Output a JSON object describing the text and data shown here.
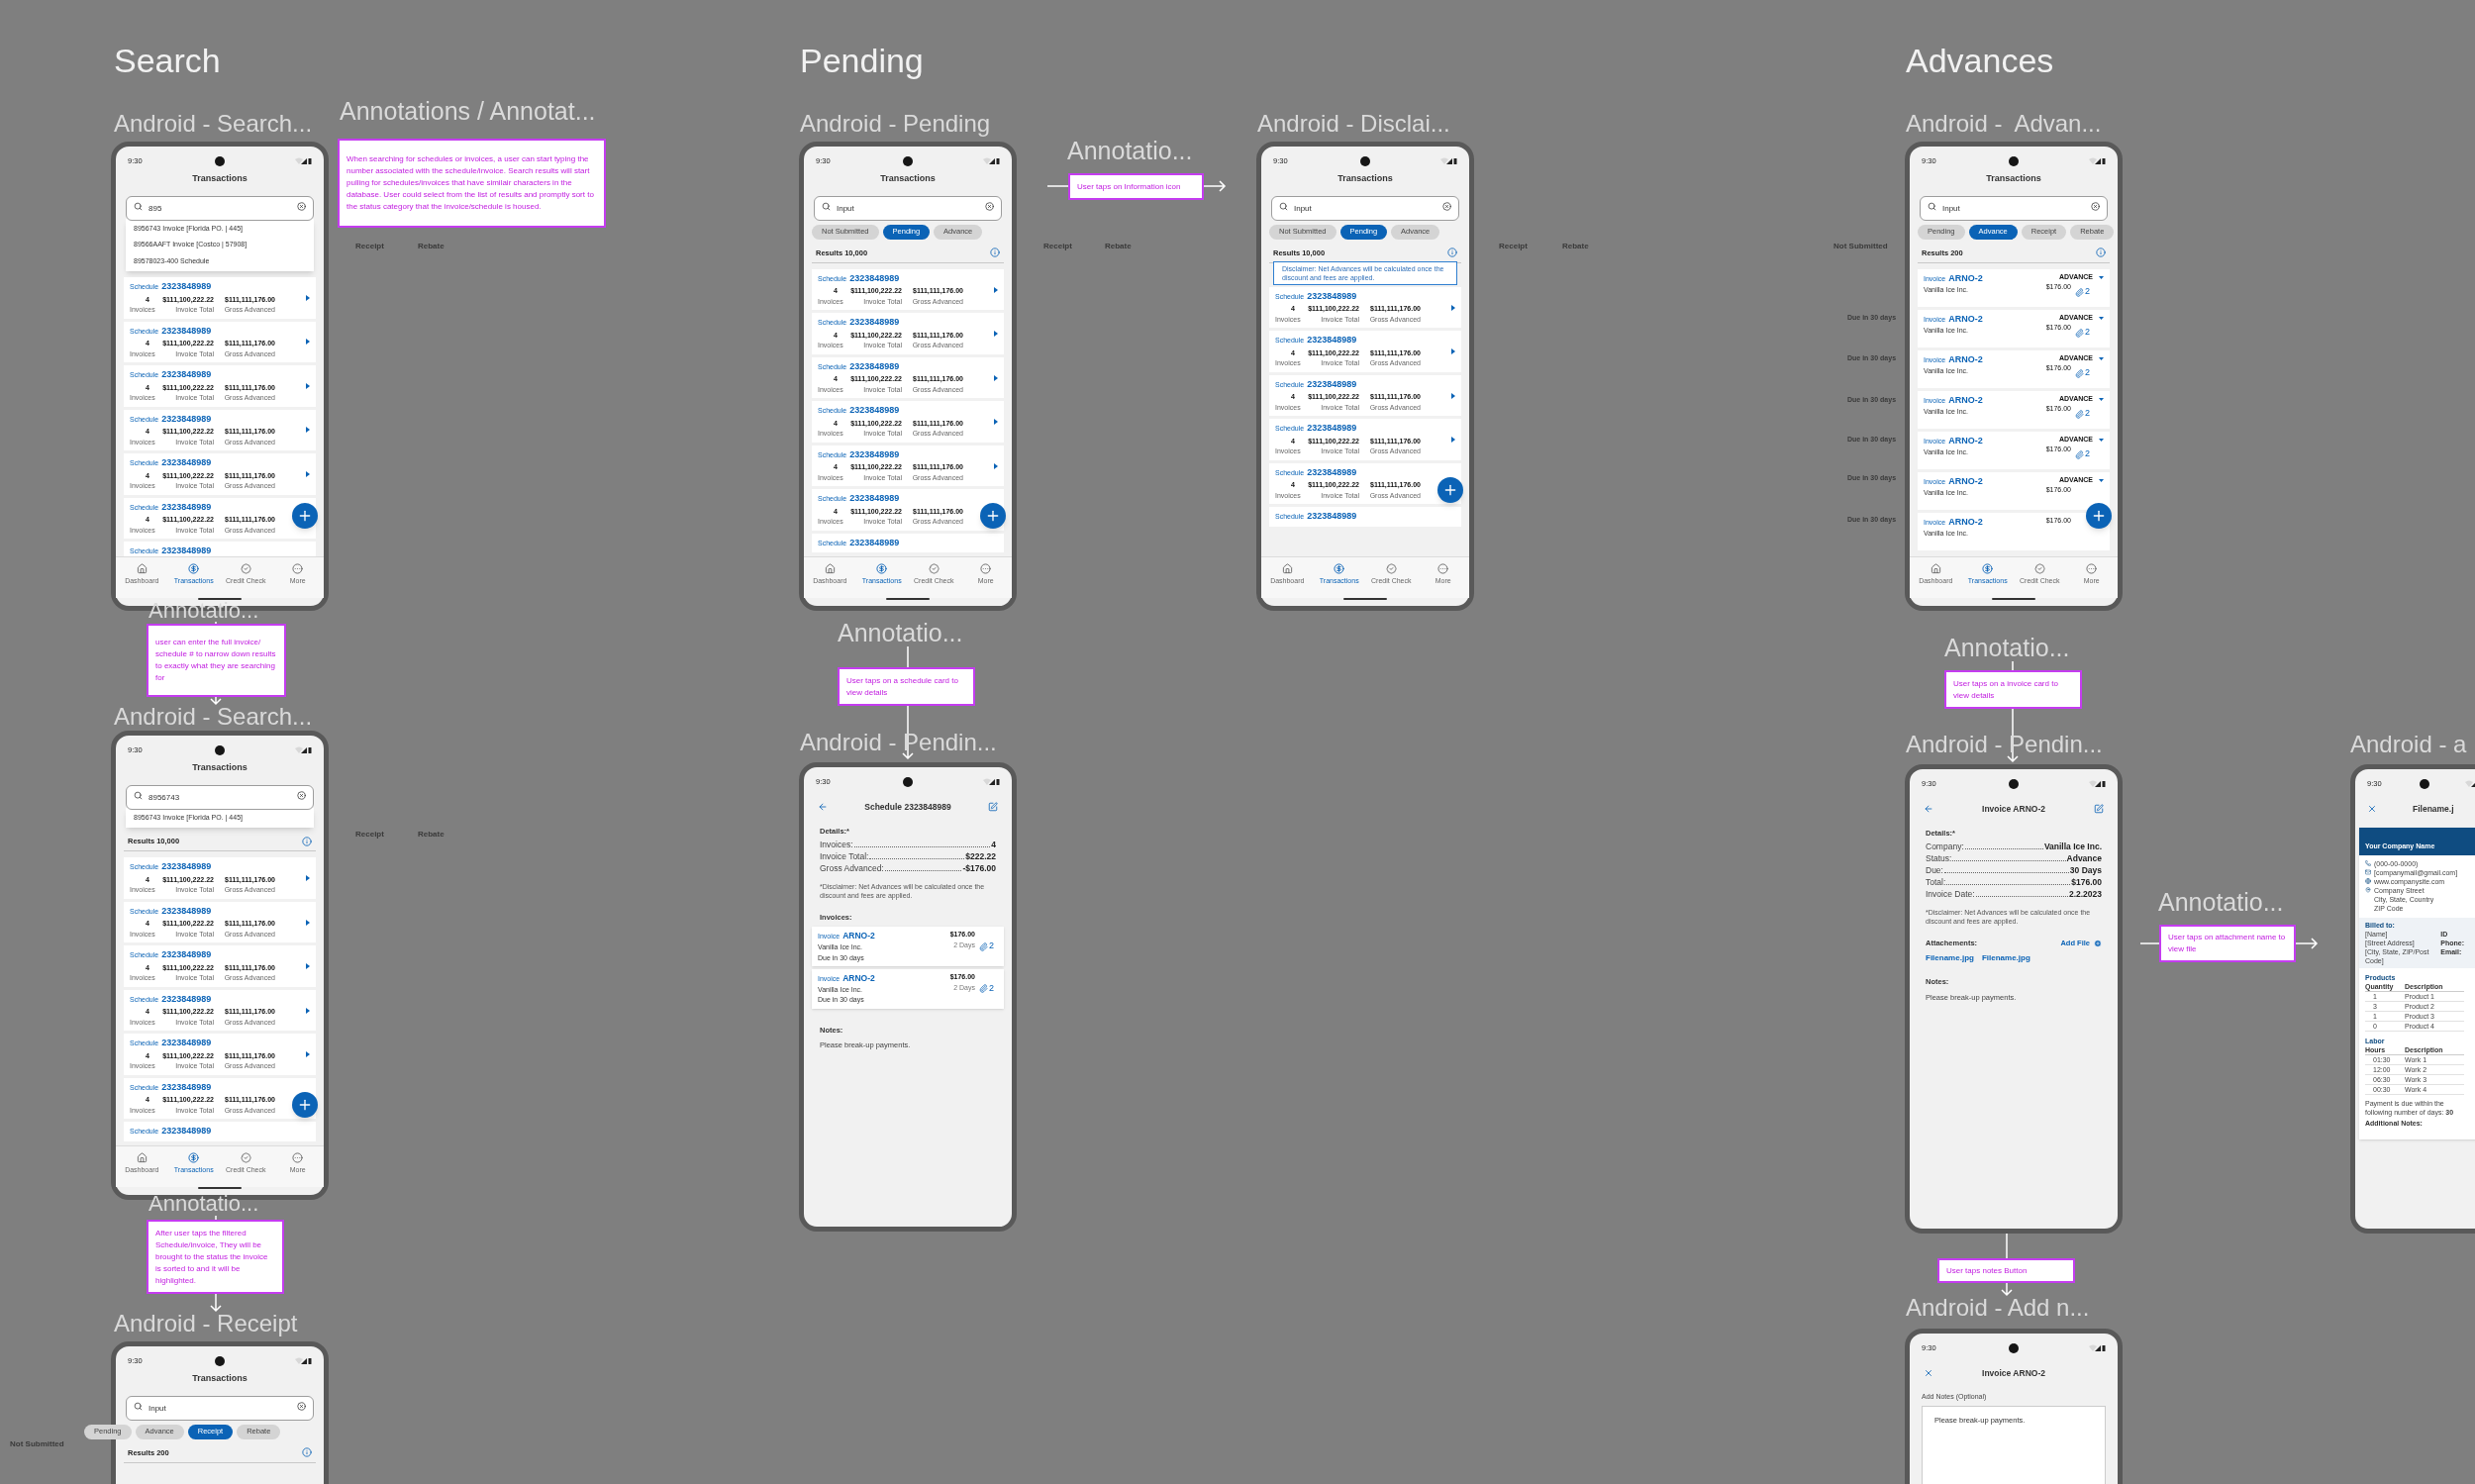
{
  "sections": [
    {
      "title": "Search"
    },
    {
      "title": "Pending"
    },
    {
      "title": "Advances"
    }
  ],
  "frames": [
    {
      "kind": "list",
      "label": "Android - Search...",
      "time": "9:30",
      "title": "Transactions",
      "search": {
        "value": "895"
      },
      "suggestions": [
        "8956743 Invoice [Florida PO. | 445]",
        "89566AAFT Invoice [Costco | 57908]",
        "89578023-400 Schedule"
      ],
      "cards": [
        {
          "label": "Schedule",
          "number": "2323848989",
          "invoices": "4",
          "invoices_label": "Invoices",
          "total": "$111,100,222.22",
          "total_label": "Invoice Total",
          "advanced": "$111,111,176.00",
          "advanced_label": "Gross Advanced"
        },
        {
          "label": "Schedule",
          "number": "2323848989",
          "invoices": "4",
          "invoices_label": "Invoices",
          "total": "$111,100,222.22",
          "total_label": "Invoice Total",
          "advanced": "$111,111,176.00",
          "advanced_label": "Gross Advanced"
        },
        {
          "label": "Schedule",
          "number": "2323848989",
          "invoices": "4",
          "invoices_label": "Invoices",
          "total": "$111,100,222.22",
          "total_label": "Invoice Total",
          "advanced": "$111,111,176.00",
          "advanced_label": "Gross Advanced"
        },
        {
          "label": "Schedule",
          "number": "2323848989",
          "invoices": "4",
          "invoices_label": "Invoices",
          "total": "$111,100,222.22",
          "total_label": "Invoice Total",
          "advanced": "$111,111,176.00",
          "advanced_label": "Gross Advanced"
        },
        {
          "label": "Schedule",
          "number": "2323848989",
          "invoices": "4",
          "invoices_label": "Invoices",
          "total": "$111,100,222.22",
          "total_label": "Invoice Total",
          "advanced": "$111,111,176.00",
          "advanced_label": "Gross Advanced"
        },
        {
          "label": "Schedule",
          "number": "2323848989",
          "invoices": "4",
          "invoices_label": "Invoices",
          "total": "$111,100,222.22",
          "total_label": "Invoice Total",
          "advanced": "$111,111,176.00",
          "advanced_label": "Gross Advanced"
        },
        {
          "label": "Schedule",
          "number": "2323848989"
        }
      ],
      "nav": [
        {
          "label": "Dashboard",
          "selected": false
        },
        {
          "label": "Transactions",
          "selected": true
        },
        {
          "label": "Credit Check",
          "selected": false
        },
        {
          "label": "More",
          "selected": false
        }
      ]
    },
    {
      "kind": "list",
      "label": "Android - Search...",
      "time": "9:30",
      "title": "Transactions",
      "search": {
        "value": "8956743"
      },
      "suggestions": [
        "8956743 Invoice [Florida PO. | 445]"
      ],
      "results": "Results 10,000",
      "cards": [
        {
          "label": "Schedule",
          "number": "2323848989",
          "invoices": "4",
          "invoices_label": "Invoices",
          "total": "$111,100,222.22",
          "total_label": "Invoice Total",
          "advanced": "$111,111,176.00",
          "advanced_label": "Gross Advanced"
        },
        {
          "label": "Schedule",
          "number": "2323848989",
          "invoices": "4",
          "invoices_label": "Invoices",
          "total": "$111,100,222.22",
          "total_label": "Invoice Total",
          "advanced": "$111,111,176.00",
          "advanced_label": "Gross Advanced"
        },
        {
          "label": "Schedule",
          "number": "2323848989",
          "invoices": "4",
          "invoices_label": "Invoices",
          "total": "$111,100,222.22",
          "total_label": "Invoice Total",
          "advanced": "$111,111,176.00",
          "advanced_label": "Gross Advanced"
        },
        {
          "label": "Schedule",
          "number": "2323848989",
          "invoices": "4",
          "invoices_label": "Invoices",
          "total": "$111,100,222.22",
          "total_label": "Invoice Total",
          "advanced": "$111,111,176.00",
          "advanced_label": "Gross Advanced"
        },
        {
          "label": "Schedule",
          "number": "2323848989",
          "invoices": "4",
          "invoices_label": "Invoices",
          "total": "$111,100,222.22",
          "total_label": "Invoice Total",
          "advanced": "$111,111,176.00",
          "advanced_label": "Gross Advanced"
        },
        {
          "label": "Schedule",
          "number": "2323848989",
          "invoices": "4",
          "invoices_label": "Invoices",
          "total": "$111,100,222.22",
          "total_label": "Invoice Total",
          "advanced": "$111,111,176.00",
          "advanced_label": "Gross Advanced"
        },
        {
          "label": "Schedule",
          "number": "2323848989"
        }
      ],
      "nav": [
        {
          "label": "Dashboard",
          "selected": false
        },
        {
          "label": "Transactions",
          "selected": true
        },
        {
          "label": "Credit Check",
          "selected": false
        },
        {
          "label": "More",
          "selected": false
        }
      ]
    },
    {
      "kind": "list",
      "label": "Android - Receipt",
      "time": "9:30",
      "title": "Transactions",
      "search": {
        "value": "Input"
      },
      "chips": [
        {
          "label": "Pending",
          "selected": false
        },
        {
          "label": "Advance",
          "selected": false
        },
        {
          "label": "Receipt",
          "selected": true
        },
        {
          "label": "Rebate",
          "selected": false
        }
      ],
      "results": "Results 200"
    },
    {
      "kind": "list",
      "label": "Android - Pending",
      "time": "9:30",
      "title": "Transactions",
      "search": {
        "value": "Input"
      },
      "chips": [
        {
          "label": "Not Submitted",
          "selected": false
        },
        {
          "label": "Pending",
          "selected": true
        },
        {
          "label": "Advance",
          "selected": false
        }
      ],
      "results": "Results 10,000",
      "cards": [
        {
          "label": "Schedule",
          "number": "2323848989",
          "invoices": "4",
          "invoices_label": "Invoices",
          "total": "$111,100,222.22",
          "total_label": "Invoice Total",
          "advanced": "$111,111,176.00",
          "advanced_label": "Gross Advanced"
        },
        {
          "label": "Schedule",
          "number": "2323848989",
          "invoices": "4",
          "invoices_label": "Invoices",
          "total": "$111,100,222.22",
          "total_label": "Invoice Total",
          "advanced": "$111,111,176.00",
          "advanced_label": "Gross Advanced"
        },
        {
          "label": "Schedule",
          "number": "2323848989",
          "invoices": "4",
          "invoices_label": "Invoices",
          "total": "$111,100,222.22",
          "total_label": "Invoice Total",
          "advanced": "$111,111,176.00",
          "advanced_label": "Gross Advanced"
        },
        {
          "label": "Schedule",
          "number": "2323848989",
          "invoices": "4",
          "invoices_label": "Invoices",
          "total": "$111,100,222.22",
          "total_label": "Invoice Total",
          "advanced": "$111,111,176.00",
          "advanced_label": "Gross Advanced"
        },
        {
          "label": "Schedule",
          "number": "2323848989",
          "invoices": "4",
          "invoices_label": "Invoices",
          "total": "$111,100,222.22",
          "total_label": "Invoice Total",
          "advanced": "$111,111,176.00",
          "advanced_label": "Gross Advanced"
        },
        {
          "label": "Schedule",
          "number": "2323848989",
          "invoices": "4",
          "invoices_label": "Invoices",
          "total": "$111,100,222.22",
          "total_label": "Invoice Total",
          "advanced": "$111,111,176.00",
          "advanced_label": "Gross Advanced"
        },
        {
          "label": "Schedule",
          "number": "2323848989"
        }
      ],
      "nav": [
        {
          "label": "Dashboard",
          "selected": false
        },
        {
          "label": "Transactions",
          "selected": true
        },
        {
          "label": "Credit Check",
          "selected": false
        },
        {
          "label": "More",
          "selected": false
        }
      ]
    },
    {
      "kind": "list",
      "label": "Android - Disclai...",
      "time": "9:30",
      "title": "Transactions",
      "search": {
        "value": "Input"
      },
      "chips": [
        {
          "label": "Not Submitted",
          "selected": false
        },
        {
          "label": "Pending",
          "selected": true
        },
        {
          "label": "Advance",
          "selected": false
        }
      ],
      "results": "Results 10,000",
      "tooltip": "Disclaimer: Net Advances will be calculated once the discount and fees are applied.",
      "cards": [
        {
          "label": "Schedule",
          "number": "2323848989",
          "invoices": "4",
          "invoices_label": "Invoices",
          "total": "$111,100,222.22",
          "total_label": "Invoice Total",
          "advanced": "$111,111,176.00",
          "advanced_label": "Gross Advanced"
        },
        {
          "label": "Schedule",
          "number": "2323848989",
          "invoices": "4",
          "invoices_label": "Invoices",
          "total": "$111,100,222.22",
          "total_label": "Invoice Total",
          "advanced": "$111,111,176.00",
          "advanced_label": "Gross Advanced"
        },
        {
          "label": "Schedule",
          "number": "2323848989",
          "invoices": "4",
          "invoices_label": "Invoices",
          "total": "$111,100,222.22",
          "total_label": "Invoice Total",
          "advanced": "$111,111,176.00",
          "advanced_label": "Gross Advanced"
        },
        {
          "label": "Schedule",
          "number": "2323848989",
          "invoices": "4",
          "invoices_label": "Invoices",
          "total": "$111,100,222.22",
          "total_label": "Invoice Total",
          "advanced": "$111,111,176.00",
          "advanced_label": "Gross Advanced"
        },
        {
          "label": "Schedule",
          "number": "2323848989",
          "invoices": "4",
          "invoices_label": "Invoices",
          "total": "$111,100,222.22",
          "total_label": "Invoice Total",
          "advanced": "$111,111,176.00",
          "advanced_label": "Gross Advanced"
        },
        {
          "label": "Schedule",
          "number": "2323848989"
        }
      ],
      "nav": [
        {
          "label": "Dashboard",
          "selected": false
        },
        {
          "label": "Transactions",
          "selected": true
        },
        {
          "label": "Credit Check",
          "selected": false
        },
        {
          "label": "More",
          "selected": false
        }
      ]
    },
    {
      "kind": "detail",
      "label": "Android - Pendin...",
      "time": "9:30",
      "header": {
        "title": "Schedule 2323848989",
        "back_button": true,
        "edit_button": true
      },
      "details_title": "Details:*",
      "details": [
        {
          "label": "Invoices:",
          "value": "4"
        },
        {
          "label": "Invoice Total:",
          "value": "$222.22"
        },
        {
          "label": "Gross Advanced:",
          "value": "-$176.00"
        }
      ],
      "disclaimer": "*Disclaimer: Net Advances will be calculated once the discount and fees are applied.",
      "invoices_title": "Invoices:",
      "invoices": [
        {
          "label": "Invoice",
          "number": "ARNO-2",
          "company": "Vanilla Ice Inc.",
          "due": "Due in 30 days",
          "amount": "$176.00",
          "days": "2 Days",
          "attachments": "2"
        },
        {
          "label": "Invoice",
          "number": "ARNO-2",
          "company": "Vanilla Ice Inc.",
          "due": "Due in 30 days",
          "amount": "$176.00",
          "days": "2 Days",
          "attachments": "2"
        }
      ],
      "notes_title": "Notes:",
      "notes": "Please break-up payments."
    },
    {
      "kind": "list",
      "label": "Android -  Advan...",
      "time": "9:30",
      "title": "Transactions",
      "search": {
        "value": "Input"
      },
      "chips": [
        {
          "label": "Pending",
          "selected": false
        },
        {
          "label": "Advance",
          "selected": true
        },
        {
          "label": "Receipt",
          "selected": false
        },
        {
          "label": "Rebate",
          "selected": false
        }
      ],
      "results": "Results 200",
      "invoice_cards": [
        {
          "label": "Invoice",
          "number": "ARNO-2",
          "company": "Vanilla Ice Inc.",
          "status": "ADVANCE",
          "amount": "$176.00",
          "attachments": "2"
        },
        {
          "label": "Invoice",
          "number": "ARNO-2",
          "company": "Vanilla Ice Inc.",
          "status": "ADVANCE",
          "amount": "$176.00",
          "attachments": "2"
        },
        {
          "label": "Invoice",
          "number": "ARNO-2",
          "company": "Vanilla Ice Inc.",
          "status": "ADVANCE",
          "amount": "$176.00",
          "attachments": "2"
        },
        {
          "label": "Invoice",
          "number": "ARNO-2",
          "company": "Vanilla Ice Inc.",
          "status": "ADVANCE",
          "amount": "$176.00",
          "attachments": "2"
        },
        {
          "label": "Invoice",
          "number": "ARNO-2",
          "company": "Vanilla Ice Inc.",
          "status": "ADVANCE",
          "amount": "$176.00",
          "attachments": "2"
        },
        {
          "label": "Invoice",
          "number": "ARNO-2",
          "company": "Vanilla Ice Inc.",
          "status": "ADVANCE",
          "amount": "$176.00"
        },
        {
          "label": "Invoice",
          "number": "ARNO-2",
          "company": "Vanilla Ice Inc.",
          "amount": "$176.00"
        }
      ],
      "nav": [
        {
          "label": "Dashboard",
          "selected": false
        },
        {
          "label": "Transactions",
          "selected": true
        },
        {
          "label": "Credit Check",
          "selected": false
        },
        {
          "label": "More",
          "selected": false
        }
      ]
    },
    {
      "kind": "detail",
      "label": "Android - Pendin...",
      "time": "9:30",
      "header": {
        "title": "Invoice ARNO-2",
        "back_button": true,
        "edit_button": true
      },
      "details_title": "Details:*",
      "details": [
        {
          "label": "Company:",
          "value": "Vanilla Ice Inc."
        },
        {
          "label": "Status:",
          "value": "Advance"
        },
        {
          "label": "Due:",
          "value": "30 Days"
        },
        {
          "label": "Total:",
          "value": "$176.00"
        },
        {
          "label": "Invoice Date:",
          "value": "2.2.2023"
        }
      ],
      "disclaimer": "*Disclaimer: Net Advances will be calculated once the discount and fees are applied.",
      "attachments": {
        "title": "Attachements:",
        "action": "Add File",
        "files": [
          "Filename.jpg",
          "Filename.jpg"
        ]
      },
      "notes_title": "Notes:",
      "notes": "Please break-up payments."
    },
    {
      "kind": "notes",
      "label": "Android - Add n...",
      "time": "9:30",
      "header": {
        "title": "Invoice ARNO-2",
        "close_button": true
      },
      "field_label": "Add Notes (Optional)",
      "notes_value": "Please break-up payments."
    },
    {
      "kind": "file",
      "label": "Android - a",
      "time": "9:30",
      "header": {
        "title": "Filename.j",
        "close_button": true
      },
      "document": {
        "company": "Your Company Name",
        "contacts": [
          "(000-00-0000)",
          "[companymail@gmail.com]",
          "www.companysite.com",
          "Company Street",
          "City, State, Country",
          "ZIP Code"
        ],
        "billed_title": "Billed to:",
        "billed": [
          "[Name]",
          "[Street Address]",
          "[City, State, ZIP/Post Code]"
        ],
        "billed_fields": [
          "ID",
          "Phone:",
          "Email:"
        ],
        "tables": [
          {
            "title": "Products",
            "columns": [
              "Quantity",
              "Description"
            ],
            "rows": [
              [
                "1",
                "Product 1"
              ],
              [
                "3",
                "Product 2"
              ],
              [
                "1",
                "Product 3"
              ],
              [
                "0",
                "Product 4"
              ]
            ]
          },
          {
            "title": "Labor",
            "columns": [
              "Hours",
              "Description"
            ],
            "rows": [
              [
                "01:30",
                "Work 1"
              ],
              [
                "12:00",
                "Work 2"
              ],
              [
                "06:30",
                "Work 3"
              ],
              [
                "00:30",
                "Work 4"
              ]
            ]
          }
        ],
        "footer": "Payment is due within the following number of days: **30**",
        "notes_label": "Additional Notes:"
      }
    }
  ],
  "annotations": [
    {
      "label": "Annotations / Annotat...",
      "text": "When searching for schedules or invoices, a user can start typing the number associated with the schedule/invoice. Search results will start pulling for schedules/invoices that have similair characters in the database. User could select from the list of results and promptly sort to the status category that the invoice/schedule is housed."
    },
    {
      "label": "Annotatio...",
      "text": "user can enter the full invoice/ schedule # to narrow down results to exactly what they are searching for"
    },
    {
      "label": "Annotatio...",
      "text": "After user taps the filtered Schedule/invoice, They will be brought to the status the invoice is sorted to and it will be highlighted."
    },
    {
      "label": "Annotatio...",
      "text": "User taps on Information icon"
    },
    {
      "label": "Annotatio...",
      "text": "User taps on a schedule card to view details"
    },
    {
      "label": "Annotatio...",
      "text": "User taps on a invoice card to view details"
    },
    {
      "label": "Annotatio...",
      "text": "User taps on attachment name to view file"
    },
    {
      "text": "User taps notes Button"
    }
  ],
  "canvas_labels": [
    "Receipt",
    "Rebate",
    "Receipt",
    "Rebate",
    "Receipt",
    "Rebate",
    "Receipt",
    "Rebate",
    "Not Submitted",
    "Due in 30 days",
    "Due in 30 days",
    "Due in 30 days",
    "Due in 30 days",
    "Due in 30 days",
    "Due in 30 days",
    "Not Submitted"
  ]
}
